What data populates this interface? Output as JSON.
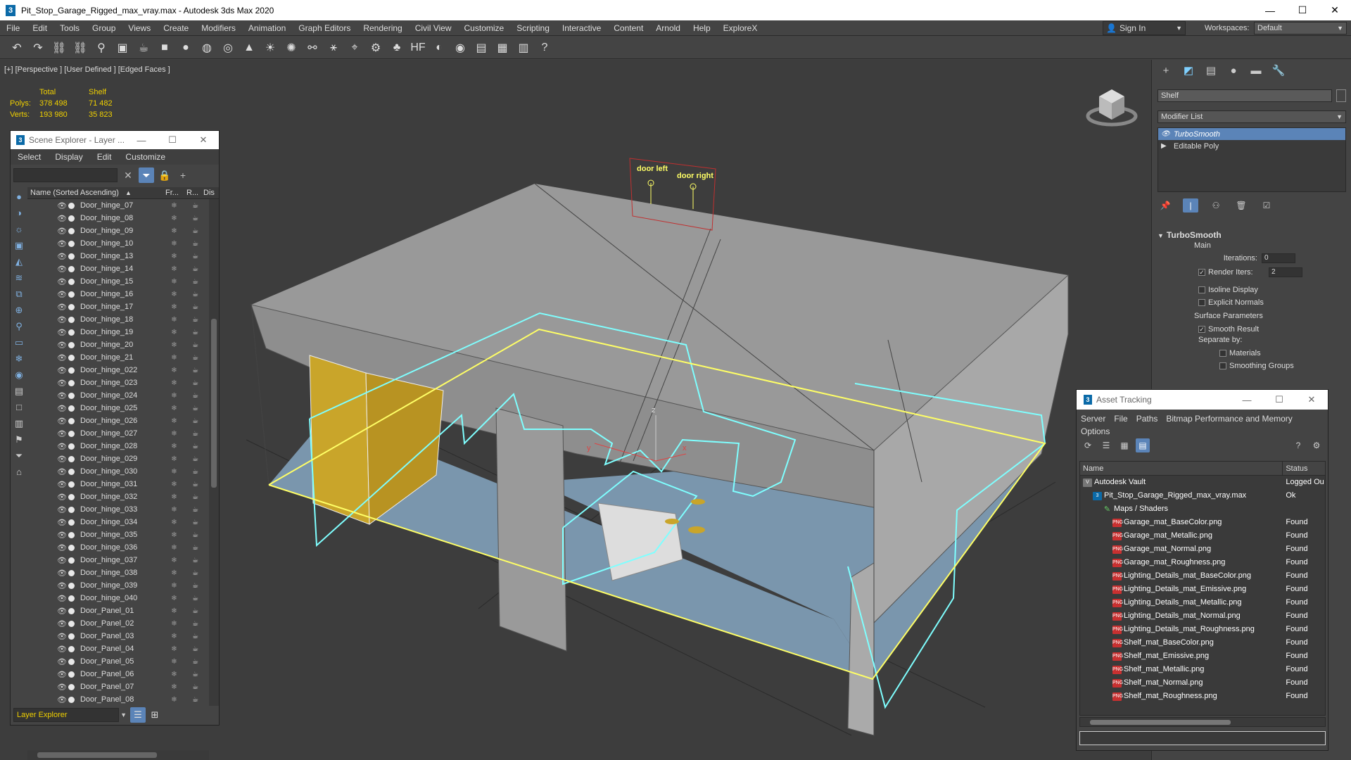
{
  "window": {
    "title": "Pit_Stop_Garage_Rigged_max_vray.max - Autodesk 3ds Max 2020",
    "app_icon": "3",
    "minimize": "—",
    "maximize": "☐",
    "close": "✕"
  },
  "menu": [
    "File",
    "Edit",
    "Tools",
    "Group",
    "Views",
    "Create",
    "Modifiers",
    "Animation",
    "Graph Editors",
    "Rendering",
    "Civil View",
    "Customize",
    "Scripting",
    "Interactive",
    "Content",
    "Arnold",
    "Help",
    "ExploreX"
  ],
  "signin": {
    "label": "Sign In",
    "arrow": "▼"
  },
  "workspaces": {
    "label": "Workspaces:",
    "value": "Default",
    "arrow": "▼"
  },
  "toolbar_icons": [
    "undo-icon",
    "redo-icon",
    "link-icon",
    "unlink-icon",
    "bind-icon",
    "selection-icon",
    "teapot-icon",
    "box-icon",
    "sphere-icon",
    "geosphere-icon",
    "torus-icon",
    "cone-icon",
    "light-icon",
    "sun-icon",
    "particles-icon",
    "bones-icon",
    "camera-icon",
    "helper-icon",
    "foliage-icon",
    "hf-icon",
    "material-icon",
    "render-icon",
    "render-frame-icon",
    "render-active-icon",
    "asset-icon",
    "help-icon"
  ],
  "toolbar_glyphs": [
    "↶",
    "↷",
    "⛓",
    "⛓",
    "⚲",
    "▣",
    "☕",
    "■",
    "●",
    "◍",
    "◎",
    "▲",
    "☀",
    "✺",
    "⚯",
    "⚹",
    "⌖",
    "⚙",
    "♣",
    "HF",
    "◐",
    "◉",
    "▤",
    "▦",
    "▥",
    "?"
  ],
  "viewport": {
    "label": "[+] [Perspective ] [User Defined ] [Edged Faces ]",
    "stats": {
      "col_total": "Total",
      "col_shelf": "Shelf",
      "polys_label": "Polys:",
      "polys_total": "378 498",
      "polys_shelf": "71 482",
      "verts_label": "Verts:",
      "verts_total": "193 980",
      "verts_shelf": "35 823"
    },
    "annotation_door_left": "door left",
    "annotation_door_right": "door right",
    "gizmo_x": "x",
    "gizmo_y": "y",
    "gizmo_z": "z"
  },
  "scene_explorer": {
    "title": "Scene Explorer - Layer ...",
    "menu": [
      "Select",
      "Display",
      "Edit",
      "Customize"
    ],
    "header_name": "Name (Sorted Ascending)",
    "header_sort": "▲",
    "header_fr": "Fr...",
    "header_r": "R...",
    "header_d": "Dis",
    "rows": [
      "Door_hinge_07",
      "Door_hinge_08",
      "Door_hinge_09",
      "Door_hinge_10",
      "Door_hinge_13",
      "Door_hinge_14",
      "Door_hinge_15",
      "Door_hinge_16",
      "Door_hinge_17",
      "Door_hinge_18",
      "Door_hinge_19",
      "Door_hinge_20",
      "Door_hinge_21",
      "Door_hinge_022",
      "Door_hinge_023",
      "Door_hinge_024",
      "Door_hinge_025",
      "Door_hinge_026",
      "Door_hinge_027",
      "Door_hinge_028",
      "Door_hinge_029",
      "Door_hinge_030",
      "Door_hinge_031",
      "Door_hinge_032",
      "Door_hinge_033",
      "Door_hinge_034",
      "Door_hinge_035",
      "Door_hinge_036",
      "Door_hinge_037",
      "Door_hinge_038",
      "Door_hinge_039",
      "Door_hinge_040",
      "Door_Panel_01",
      "Door_Panel_02",
      "Door_Panel_03",
      "Door_Panel_04",
      "Door_Panel_05",
      "Door_Panel_06",
      "Door_Panel_07",
      "Door_Panel_08"
    ],
    "footer_layer": "Layer Explorer"
  },
  "command_panel": {
    "object_name": "Shelf",
    "modifier_list": "Modifier List",
    "stack": [
      {
        "label": "TurboSmooth",
        "selected": true
      },
      {
        "label": "Editable Poly",
        "selected": false
      }
    ],
    "rollout_title": "TurboSmooth",
    "main_label": "Main",
    "iterations_label": "Iterations:",
    "iterations_value": "0",
    "render_iters_label": "Render Iters:",
    "render_iters_value": "2",
    "isoline_display": "Isoline Display",
    "explicit_normals": "Explicit Normals",
    "surface_parameters": "Surface Parameters",
    "smooth_result": "Smooth Result",
    "separate_by": "Separate by:",
    "materials": "Materials",
    "smoothing_groups": "Smoothing Groups"
  },
  "asset_tracking": {
    "title": "Asset Tracking",
    "menu": [
      "Server",
      "File",
      "Paths",
      "Bitmap Performance and Memory",
      "Options"
    ],
    "col_name": "Name",
    "col_status": "Status",
    "rows": [
      {
        "name": "Autodesk Vault",
        "status": "Logged Ou",
        "indent": 0,
        "icon": "vault"
      },
      {
        "name": "Pit_Stop_Garage_Rigged_max_vray.max",
        "status": "Ok",
        "indent": 1,
        "icon": "max"
      },
      {
        "name": "Maps / Shaders",
        "status": "",
        "indent": 2,
        "icon": "maps"
      },
      {
        "name": "Garage_mat_BaseColor.png",
        "status": "Found",
        "indent": 3,
        "icon": "png"
      },
      {
        "name": "Garage_mat_Metallic.png",
        "status": "Found",
        "indent": 3,
        "icon": "png"
      },
      {
        "name": "Garage_mat_Normal.png",
        "status": "Found",
        "indent": 3,
        "icon": "png"
      },
      {
        "name": "Garage_mat_Roughness.png",
        "status": "Found",
        "indent": 3,
        "icon": "png"
      },
      {
        "name": "Lighting_Details_mat_BaseColor.png",
        "status": "Found",
        "indent": 3,
        "icon": "png"
      },
      {
        "name": "Lighting_Details_mat_Emissive.png",
        "status": "Found",
        "indent": 3,
        "icon": "png"
      },
      {
        "name": "Lighting_Details_mat_Metallic.png",
        "status": "Found",
        "indent": 3,
        "icon": "png"
      },
      {
        "name": "Lighting_Details_mat_Normal.png",
        "status": "Found",
        "indent": 3,
        "icon": "png"
      },
      {
        "name": "Lighting_Details_mat_Roughness.png",
        "status": "Found",
        "indent": 3,
        "icon": "png"
      },
      {
        "name": "Shelf_mat_BaseColor.png",
        "status": "Found",
        "indent": 3,
        "icon": "png"
      },
      {
        "name": "Shelf_mat_Emissive.png",
        "status": "Found",
        "indent": 3,
        "icon": "png"
      },
      {
        "name": "Shelf_mat_Metallic.png",
        "status": "Found",
        "indent": 3,
        "icon": "png"
      },
      {
        "name": "Shelf_mat_Normal.png",
        "status": "Found",
        "indent": 3,
        "icon": "png"
      },
      {
        "name": "Shelf_mat_Roughness.png",
        "status": "Found",
        "indent": 3,
        "icon": "png"
      }
    ]
  },
  "colors": {
    "accent": "#5b84b8",
    "stats_yellow": "#f0d000",
    "selection_cyan": "#7fffff",
    "selection_yellow": "#ffff66",
    "floor": "#7a96ad",
    "wall": "#9a9a9a"
  }
}
